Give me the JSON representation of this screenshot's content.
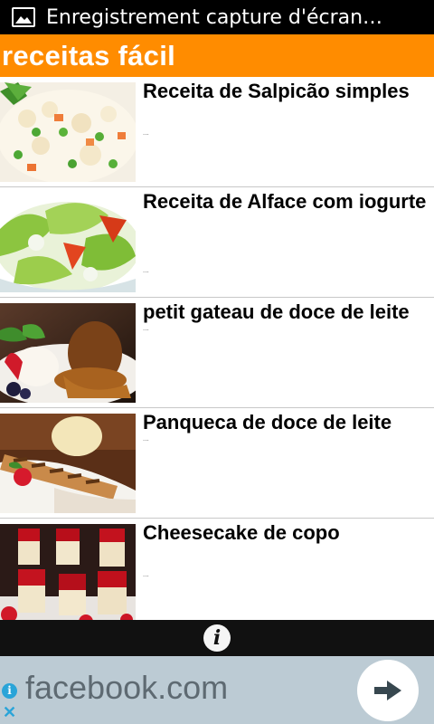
{
  "status_bar": {
    "notification_icon": "image-icon",
    "text": "Enregistrement capture d'écran…"
  },
  "app_bar": {
    "title": "receitas fácil",
    "color": "#ff8c00"
  },
  "recipes": [
    {
      "title": "Receita de Salpicão simples",
      "description": "...",
      "image": "salpicao-salad-photo"
    },
    {
      "title": "Receita de Alface com iogurte",
      "description": "...",
      "image": "lettuce-salad-photo"
    },
    {
      "title": "petit gateau de doce de leite",
      "description": "...",
      "image": "petit-gateau-photo"
    },
    {
      "title": "Panqueca de doce de leite",
      "description": "...",
      "image": "pancake-photo"
    },
    {
      "title": "Cheesecake de copo",
      "description": "...",
      "image": "cheesecake-cups-photo"
    }
  ],
  "bottom_bar": {
    "info_icon": "info-icon",
    "info_glyph": "i"
  },
  "ad_banner": {
    "text": "facebook.com",
    "info_glyph": "i",
    "close_glyph": "✕",
    "action_icon": "arrow-right-icon"
  }
}
